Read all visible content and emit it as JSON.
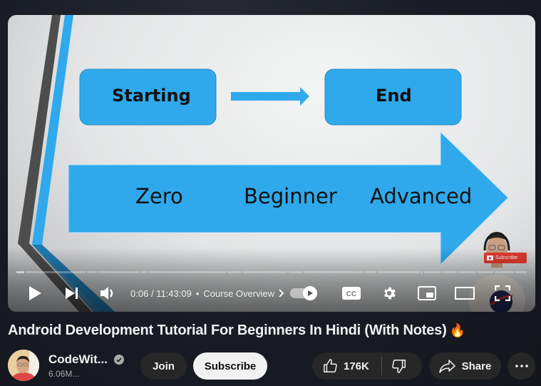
{
  "video": {
    "slide": {
      "box_left": "Starting",
      "box_right": "End",
      "arrow_labels": [
        "Zero",
        "Beginner",
        "Advanced"
      ],
      "accent_color": "#2fa9eb"
    },
    "overlay_subscribe": "Subscribe",
    "progress": {
      "played_fraction": 0.0001,
      "chapter_count": 19
    },
    "controls": {
      "current_time": "0:06",
      "duration": "11:43:09",
      "time_separator": "/",
      "chapter_separator": "•",
      "chapter_title": "Course Overview",
      "chapter_chevron": ">",
      "cc_label": "CC",
      "autoplay_on": true
    }
  },
  "details": {
    "title": "Android Development Tutorial For Beginners In Hindi (With Notes)",
    "title_emoji": "🔥",
    "channel_name": "CodeWit...",
    "subscriber_count": "6.06M...",
    "join_label": "Join",
    "subscribe_label": "Subscribe",
    "like_count": "176K",
    "share_label": "Share",
    "more_label": "⋯"
  }
}
